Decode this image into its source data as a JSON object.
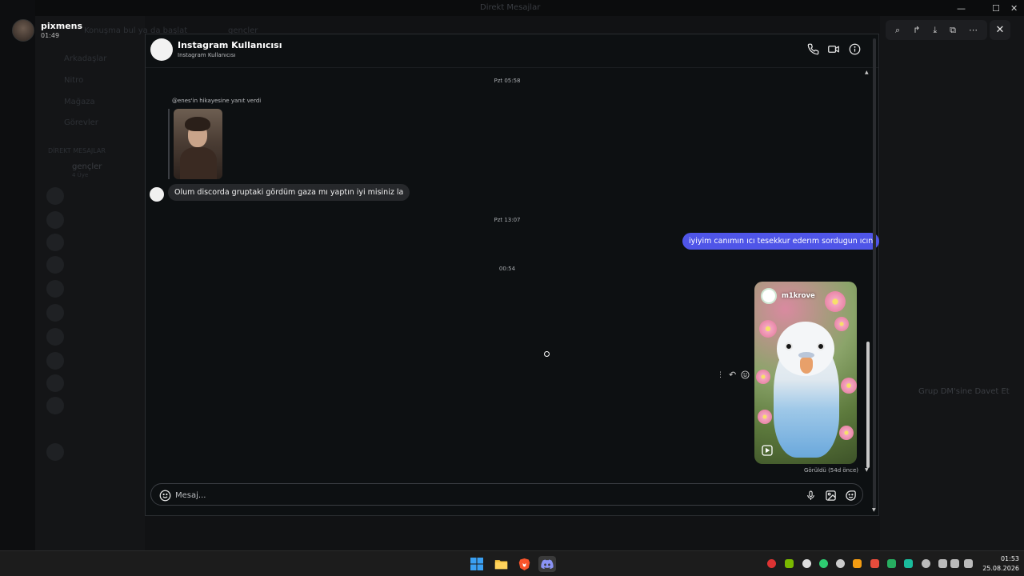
{
  "background": {
    "window_title": "Direkt Mesajlar",
    "search_placeholder": "Konuşma bul ya da başlat",
    "channel_header": "gençler",
    "items": [
      "Arkadaşlar",
      "Nitro",
      "Mağaza",
      "Görevler"
    ],
    "section": "DİREKT MESAJLAR",
    "group_name": "gençler",
    "group_members": "4 Üye",
    "invite_label": "Grup DM'sine Davet Et"
  },
  "current_user": {
    "name": "pixmens",
    "time": "01:49"
  },
  "viewer_toolbar": {
    "zoom": "⌕",
    "forward": "↱",
    "download": "⤓",
    "open": "⧉",
    "more": "⋯",
    "close": "✕"
  },
  "dm": {
    "peer_name": "Instagram Kullanıcısı",
    "peer_subtitle": "Instagram Kullanıcısı",
    "messages": [
      {
        "stamp": "Pzt 05:58"
      },
      {
        "reply_note": "@enes'in hikayesine yanıt verdi"
      },
      {
        "incoming": "Olum discorda gruptaki gördüm gaza mı yaptın iyi misiniz la"
      },
      {
        "stamp": "Pzt 13:07"
      },
      {
        "outgoing": "iyiyim canımın ıcı tesekkur ederım sordugun ıcın"
      },
      {
        "stamp": "00:54"
      }
    ],
    "shared_post_author": "m1krove",
    "seen": "Görüldü (54d önce)",
    "composer_placeholder": "Mesaj..."
  },
  "taskbar": {
    "time": "01:53",
    "date": "25.08.2026"
  },
  "colors": {
    "outgoing_bubble": "#4f55e8",
    "incoming_bubble": "#26282b",
    "modal_bg": "#0d1012"
  }
}
